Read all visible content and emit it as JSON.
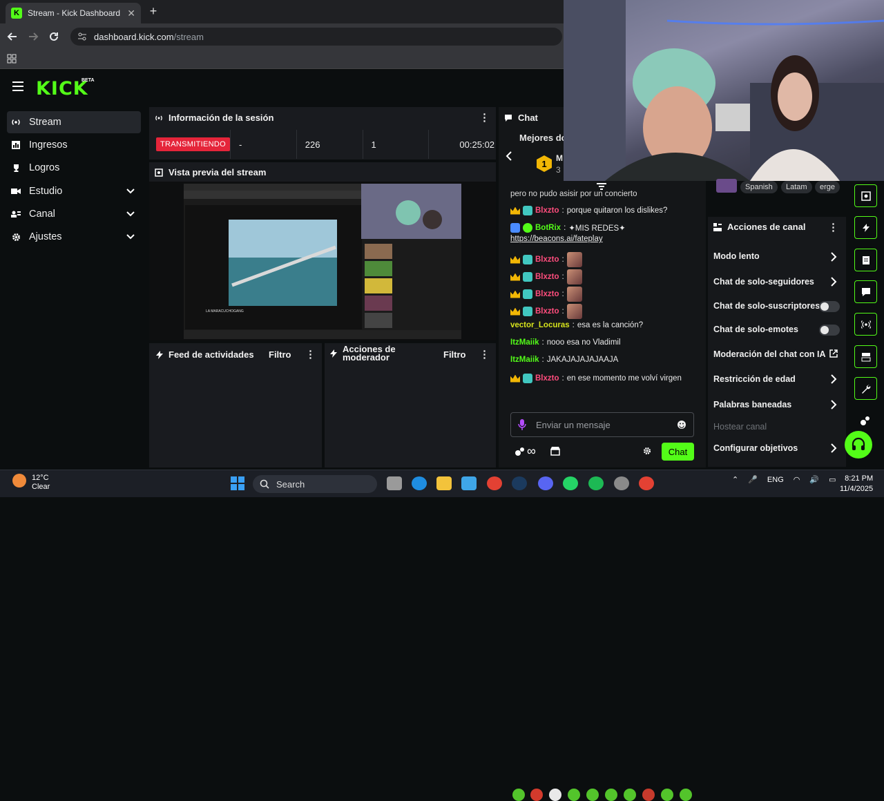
{
  "browser": {
    "tab_title": "Stream - Kick Dashboard",
    "tab_close": "✕",
    "new_tab": "+",
    "url_host": "dashboard.kick.com",
    "url_path": "/stream"
  },
  "brand": {
    "logo": "KICK",
    "beta": "BETA",
    "accent": "#53fc18"
  },
  "sidebar": {
    "items": [
      {
        "label": "Stream",
        "icon": "broadcast-icon",
        "active": true
      },
      {
        "label": "Ingresos",
        "icon": "bar-chart-icon"
      },
      {
        "label": "Logros",
        "icon": "trophy-icon"
      },
      {
        "label": "Estudio",
        "icon": "camera-icon",
        "expandable": true
      },
      {
        "label": "Canal",
        "icon": "user-card-icon",
        "expandable": true
      },
      {
        "label": "Ajustes",
        "icon": "gear-icon",
        "expandable": true
      }
    ]
  },
  "session": {
    "title": "Información de la sesión",
    "status": "TRANSMITIENDO",
    "stat_1": "-",
    "viewers": "226",
    "stat_3": "1",
    "duration": "00:25:02"
  },
  "preview": {
    "title": "Vista previa del stream",
    "inner_title": "LA MARACUCHOGANG"
  },
  "activity": {
    "title": "Feed de actividades",
    "filter": "Filtro"
  },
  "mod_actions": {
    "title_line1": "Acciones de",
    "title_line2": "moderador",
    "filter": "Filtro"
  },
  "chat": {
    "title": "Chat",
    "top_label": "Mejores do",
    "rank": "1",
    "rank_name": "M",
    "rank_sub": "3",
    "truncated_line": "pero no pudo asisir por un concierto",
    "messages": [
      {
        "user": "Blxzto",
        "color": "#ff4d7d",
        "text": "porque quitaron los dislikes?",
        "badges": [
          "crown",
          "g"
        ]
      },
      {
        "user": "BotRix",
        "color": "#53fc18",
        "text": "✦MIS REDES✦",
        "link": "https://beacons.ai/fateplay",
        "badges": [
          "bot",
          "verified"
        ]
      },
      {
        "user": "Blxzto",
        "color": "#ff4d7d",
        "text": "",
        "emote": true,
        "badges": [
          "crown",
          "g"
        ]
      },
      {
        "user": "Blxzto",
        "color": "#ff4d7d",
        "text": "",
        "emote": true,
        "badges": [
          "crown",
          "g"
        ]
      },
      {
        "user": "Blxzto",
        "color": "#ff4d7d",
        "text": "",
        "emote": true,
        "badges": [
          "crown",
          "g"
        ]
      },
      {
        "user": "Blxzto",
        "color": "#ff4d7d",
        "text": "",
        "emote": true,
        "badges": [
          "crown",
          "g"
        ]
      },
      {
        "user": "vector_Locuras",
        "color": "#d6e31c",
        "text": "esa es la canción?",
        "badges": []
      },
      {
        "user": "ItzMaiik",
        "color": "#53fc18",
        "text": "nooo esa no Vladimil",
        "badges": []
      },
      {
        "user": "ItzMaiik",
        "color": "#53fc18",
        "text": "JAKAJAJAJAJAAJA",
        "badges": []
      },
      {
        "user": "Blxzto",
        "color": "#ff4d7d",
        "text": "en ese momento me volví virgen",
        "badges": [
          "crown",
          "g"
        ]
      }
    ],
    "input_placeholder": "Enviar un mensaje",
    "send_label": "Chat",
    "infinity": "∞"
  },
  "channel_actions": {
    "title": "Acciones de canal",
    "tags": [
      "Spanish",
      "Latam",
      "erge"
    ],
    "items": [
      {
        "label": "Modo lento",
        "kind": "chevron"
      },
      {
        "label": "Chat de solo-seguidores",
        "kind": "chevron"
      },
      {
        "label": "Chat de solo-suscriptores",
        "kind": "toggle"
      },
      {
        "label": "Chat de solo-emotes",
        "kind": "toggle"
      },
      {
        "label": "Moderación del chat con IA",
        "kind": "external"
      },
      {
        "label": "Restricción de edad",
        "kind": "chevron"
      },
      {
        "label": "Palabras baneadas",
        "kind": "chevron"
      },
      {
        "label": "Hostear canal",
        "kind": "disabled"
      },
      {
        "label": "Configurar objetivos",
        "kind": "chevron"
      }
    ]
  },
  "taskbar": {
    "temperature": "12°C",
    "weather": "Clear",
    "search": "Search",
    "lang": "ENG",
    "time": "8:21 PM",
    "date": "11/4/2025"
  }
}
